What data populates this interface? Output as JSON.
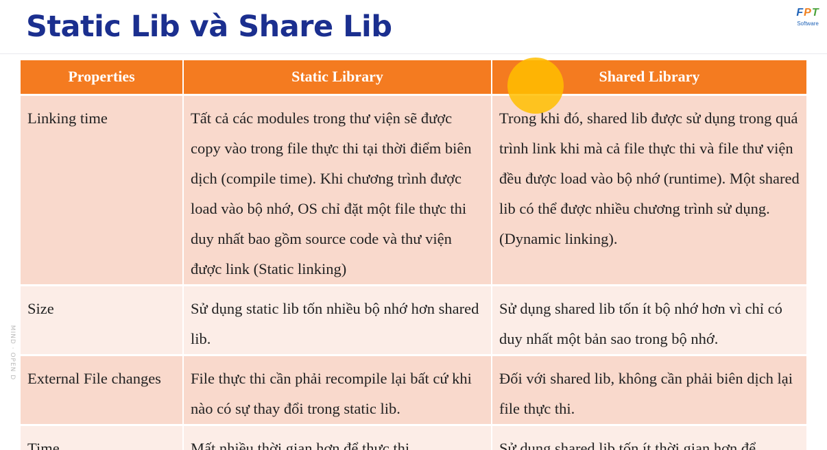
{
  "slide": {
    "title": "Static Lib và Share Lib",
    "logo_letters": [
      "F",
      "P",
      "T"
    ],
    "logo_sub": "Software",
    "side_mark": "MIND · OPEN D"
  },
  "table": {
    "headers": [
      "Properties",
      "Static Library",
      "Shared Library"
    ],
    "rows": [
      {
        "property": "Linking time",
        "static": "Tất cả các modules trong thư viện sẽ được copy vào trong file thực thi tại thời điểm biên dịch (compile time). Khi chương trình được load vào bộ nhớ, OS chỉ đặt một file thực thi duy nhất bao gồm source code và thư viện được link (Static linking)",
        "shared": "Trong khi đó, shared lib được sử dụng trong quá trình link khi mà cả file thực thi và file thư viện đều được load vào bộ nhớ (runtime). Một shared lib có thể được nhiều chương trình sử dụng. (Dynamic linking)."
      },
      {
        "property": "Size",
        "static": "Sử dụng static lib tốn nhiều bộ nhớ hơn shared lib.",
        "shared": "Sử dụng shared lib tốn ít bộ nhớ hơn vì chỉ có duy nhất một bản sao trong bộ nhớ."
      },
      {
        "property": "External File changes",
        "static": "File thực thi cần phải recompile lại bất cứ khi nào có sự thay đổi trong static lib.",
        "shared": "Đối với shared lib, không cần phải biên dịch lại file thực thi."
      },
      {
        "property": "Time",
        "static": "Mất nhiều thời gian hơn để thực thi.",
        "shared": "Sử dụng shared lib tốn ít thời gian hơn để"
      }
    ]
  }
}
